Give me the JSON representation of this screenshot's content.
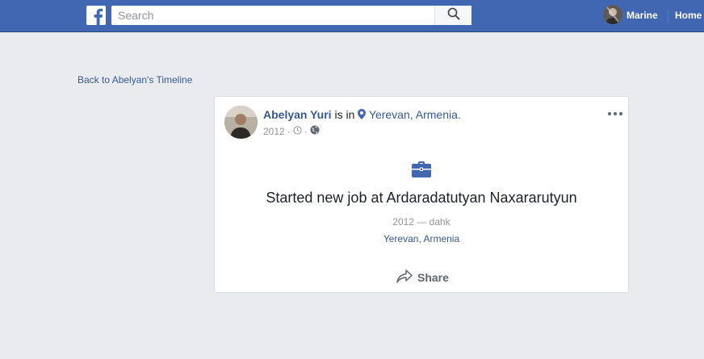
{
  "topbar": {
    "search": {
      "placeholder": "Search",
      "value": ""
    },
    "user_name": "Marine",
    "home_label": "Home",
    "brand_color": "#4267b2"
  },
  "back_link": "Back to Abelyan's Timeline",
  "post": {
    "author": "Abelyan Yuri",
    "is_in": "is in",
    "location": "Yerevan, Armenia.",
    "date": "2012",
    "meta_sep_1": "·",
    "meta_sep_2": "·",
    "headline": "Started new job at Ardaradatutyan Naxararutyun",
    "period": "2012 — dahk",
    "job_location": "Yerevan, Armenia",
    "share_label": "Share"
  },
  "icons": {
    "logo": "facebook-logo-icon",
    "search": "search-icon",
    "location": "map-pin-icon",
    "clock": "clock-icon",
    "privacy": "globe-icon",
    "more": "more-options-icon",
    "work": "briefcase-icon",
    "share": "share-arrow-icon"
  }
}
